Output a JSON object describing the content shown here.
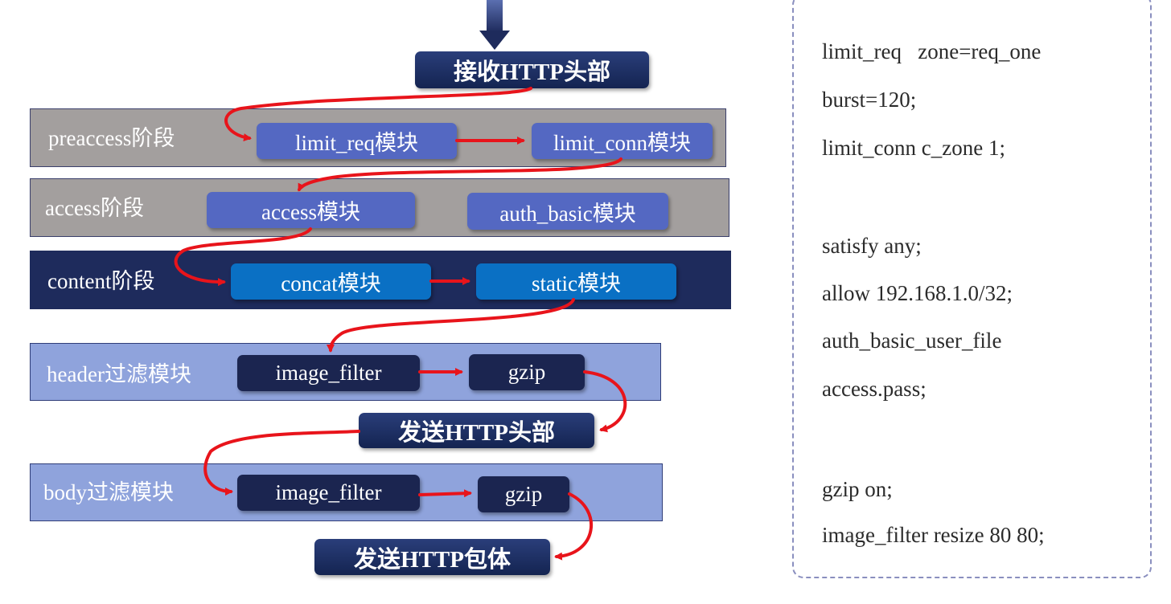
{
  "top": {
    "receive_header": "接收HTTP头部"
  },
  "phases": {
    "preaccess": {
      "label": "preaccess阶段",
      "modules": [
        "limit_req模块",
        "limit_conn模块"
      ]
    },
    "access": {
      "label": "access阶段",
      "modules": [
        "access模块",
        "auth_basic模块"
      ]
    },
    "content": {
      "label": "content阶段",
      "modules": [
        "concat模块",
        "static模块"
      ]
    },
    "header_filter": {
      "label": "header过滤模块",
      "modules": [
        "image_filter",
        "gzip"
      ]
    },
    "body_filter": {
      "label": "body过滤模块",
      "modules": [
        "image_filter",
        "gzip"
      ]
    }
  },
  "send_header": "发送HTTP头部",
  "send_body": "发送HTTP包体",
  "config_lines": [
    "limit_req   zone=req_one",
    "burst=120;",
    "limit_conn c_zone 1;",
    "satisfy any;",
    "allow 192.168.1.0/32;",
    "auth_basic_user_file",
    "access.pass;",
    "gzip on;",
    "image_filter resize 80 80;"
  ],
  "colors": {
    "arrow": "#e8141b",
    "phase_gray": "#a39f9e",
    "phase_dark": "#1e2b5c",
    "phase_light": "#8fa3dc",
    "module_purple": "#5468c2",
    "module_blue": "#0a70c4",
    "module_navy": "#1b2550"
  }
}
